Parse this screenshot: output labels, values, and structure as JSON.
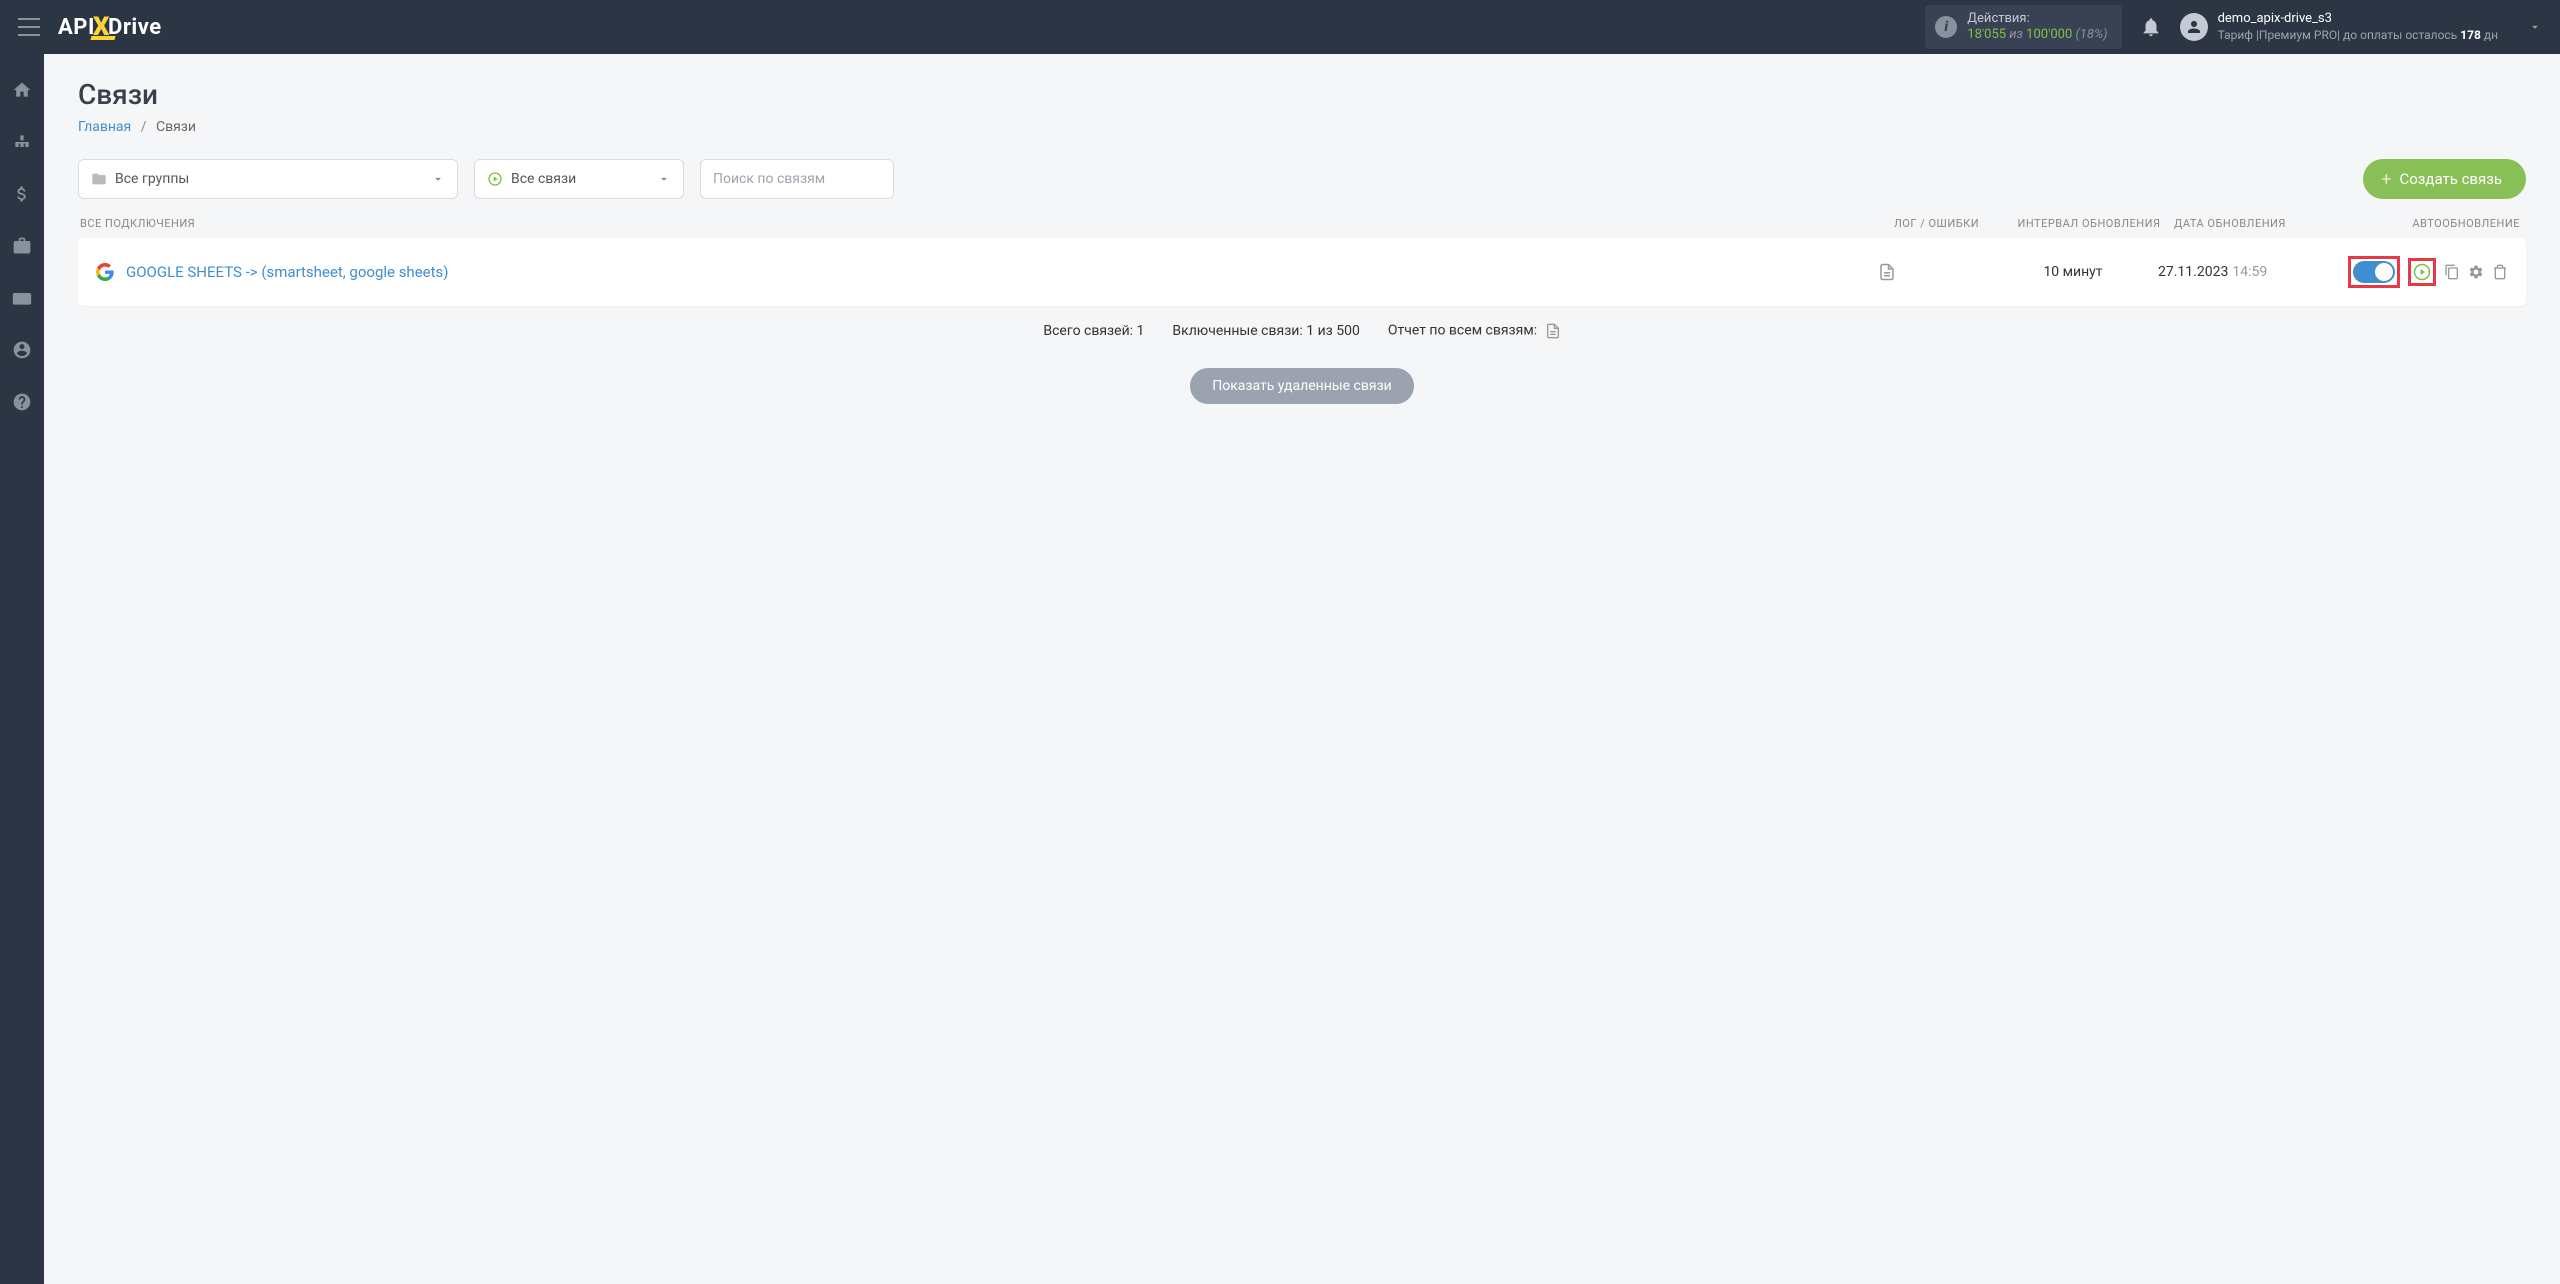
{
  "header": {
    "logo_api": "API",
    "logo_drive": "Drive",
    "actions": {
      "label": "Действия:",
      "count": "18'055",
      "of": " из ",
      "total": "100'000",
      "pct": " (18%)"
    },
    "user": {
      "name": "demo_apix-drive_s3",
      "tariff_prefix": "Тариф |Премиум PRO| до оплаты осталось ",
      "days": "178",
      "days_suffix": " дн"
    }
  },
  "page": {
    "title": "Связи",
    "breadcrumb_home": "Главная",
    "breadcrumb_sep": "/",
    "breadcrumb_current": "Связи"
  },
  "filters": {
    "groups_label": "Все группы",
    "conns_label": "Все связи",
    "search_placeholder": "Поиск по связям",
    "create_label": "Создать связь"
  },
  "columns": {
    "name": "ВСЕ ПОДКЛЮЧЕНИЯ",
    "log": "ЛОГ / ОШИБКИ",
    "interval": "ИНТЕРВАЛ ОБНОВЛЕНИЯ",
    "date": "ДАТА ОБНОВЛЕНИЯ",
    "auto": "АВТООБНОВЛЕНИЕ"
  },
  "rows": [
    {
      "name": "GOOGLE SHEETS -> (smartsheet, google sheets)",
      "interval": "10 минут",
      "date": "27.11.2023",
      "time": "14:59"
    }
  ],
  "summary": {
    "total": "Всего связей: 1",
    "enabled": "Включенные связи: 1 из 500",
    "report": "Отчет по всем связям:"
  },
  "deleted_btn": "Показать удаленные связи"
}
